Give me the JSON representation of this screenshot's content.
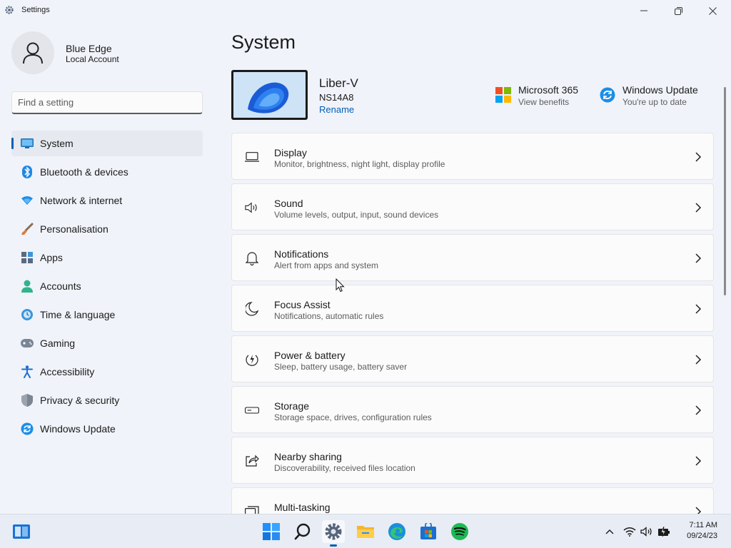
{
  "window": {
    "title": "Settings"
  },
  "user": {
    "name": "Blue Edge",
    "account_type": "Local Account"
  },
  "search": {
    "placeholder": "Find a setting",
    "value": ""
  },
  "nav": {
    "items": [
      {
        "label": "System",
        "icon": "system-icon",
        "active": true
      },
      {
        "label": "Bluetooth & devices",
        "icon": "bluetooth-icon"
      },
      {
        "label": "Network & internet",
        "icon": "wifi-icon"
      },
      {
        "label": "Personalisation",
        "icon": "brush-icon"
      },
      {
        "label": "Apps",
        "icon": "apps-icon"
      },
      {
        "label": "Accounts",
        "icon": "person-icon"
      },
      {
        "label": "Time & language",
        "icon": "globe-clock-icon"
      },
      {
        "label": "Gaming",
        "icon": "gamepad-icon"
      },
      {
        "label": "Accessibility",
        "icon": "accessibility-icon"
      },
      {
        "label": "Privacy & security",
        "icon": "shield-icon"
      },
      {
        "label": "Windows Update",
        "icon": "update-icon"
      }
    ]
  },
  "main": {
    "title": "System",
    "device": {
      "name": "Liber-V",
      "model": "NS14A8",
      "rename_label": "Rename"
    },
    "promos": [
      {
        "title": "Microsoft 365",
        "subtitle": "View benefits",
        "icon": "microsoft-logo-icon"
      },
      {
        "title": "Windows Update",
        "subtitle": "You're up to date",
        "icon": "update-icon"
      }
    ],
    "cards": [
      {
        "title": "Display",
        "subtitle": "Monitor, brightness, night light, display profile",
        "icon": "display-icon"
      },
      {
        "title": "Sound",
        "subtitle": "Volume levels, output, input, sound devices",
        "icon": "speaker-icon"
      },
      {
        "title": "Notifications",
        "subtitle": "Alert from apps and system",
        "icon": "bell-icon"
      },
      {
        "title": "Focus Assist",
        "subtitle": "Notifications, automatic rules",
        "icon": "moon-icon"
      },
      {
        "title": "Power & battery",
        "subtitle": "Sleep, battery usage, battery saver",
        "icon": "power-icon"
      },
      {
        "title": "Storage",
        "subtitle": "Storage space, drives, configuration rules",
        "icon": "storage-icon"
      },
      {
        "title": "Nearby sharing",
        "subtitle": "Discoverability, received files location",
        "icon": "share-icon"
      },
      {
        "title": "Multi-tasking",
        "subtitle": "",
        "icon": "multitask-icon"
      }
    ]
  },
  "taskbar": {
    "apps": [
      "widgets-icon",
      "start-icon",
      "search-icon",
      "settings-icon",
      "file-explorer-icon",
      "edge-icon",
      "store-icon",
      "spotify-icon"
    ],
    "active_app": "settings-icon",
    "clock": {
      "time": "7:11 AM",
      "date": "09/24/23"
    }
  },
  "colors": {
    "accent": "#005fb8",
    "background": "#f0f3f9",
    "card": "#fbfbfb"
  }
}
